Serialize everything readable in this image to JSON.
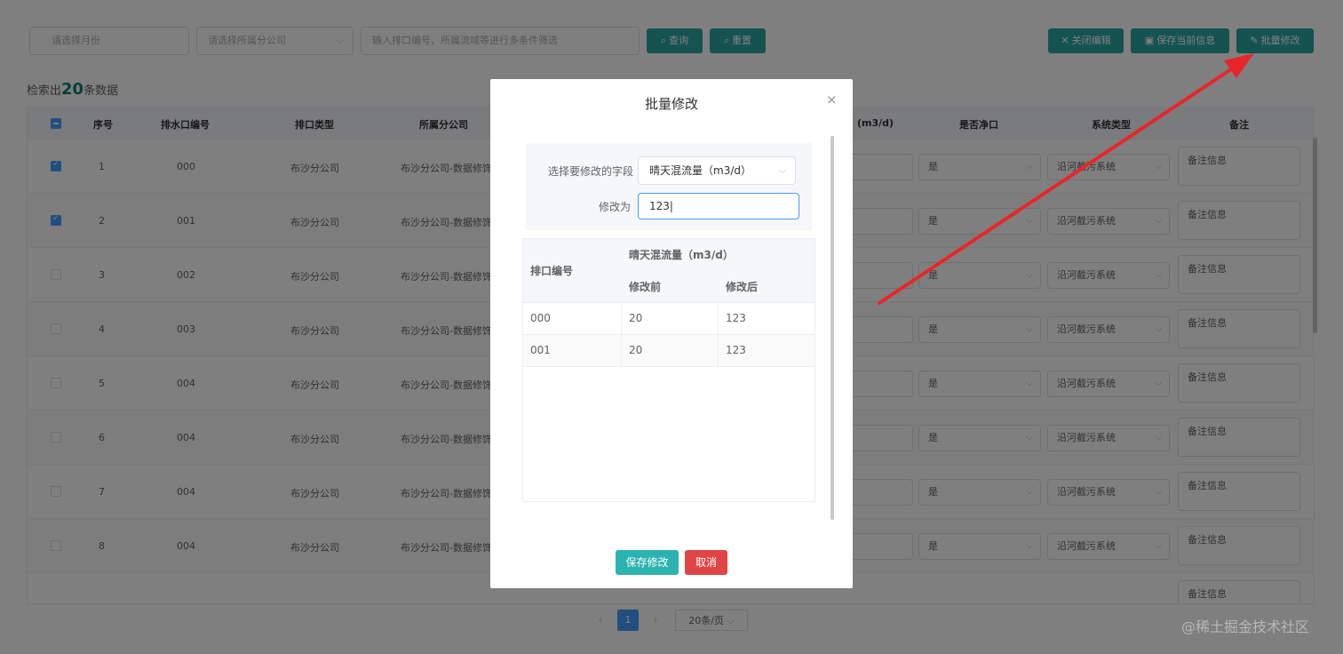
{
  "filters": {
    "month_placeholder": "请选择月份",
    "company_placeholder": "请选择所属分公司",
    "keyword_placeholder": "输入排口编号、所属流域等进行多条件筛选",
    "query_label": "查询",
    "reset_label": "重置"
  },
  "actions": {
    "close_edit_label": "关闭编辑",
    "save_current_label": "保存当前信息",
    "batch_edit_label": "批量修改"
  },
  "result": {
    "prefix": "检索出",
    "count": "20",
    "suffix": "条数据"
  },
  "table": {
    "headers": {
      "index": "序号",
      "outlet_no": "排水口编号",
      "outlet_type": "排口类型",
      "company": "所属分公司",
      "flow": "(m3/d)",
      "clean": "是否净口",
      "system": "系统类型",
      "remark": "备注"
    },
    "rows": [
      {
        "index": "1",
        "code": "000",
        "type": "布沙分公司",
        "company": "布沙分公司-数据修饰",
        "clean": "是",
        "system": "沿河截污系统",
        "remark": "备注信息",
        "checked": true
      },
      {
        "index": "2",
        "code": "001",
        "type": "布沙分公司",
        "company": "布沙分公司-数据修饰",
        "clean": "是",
        "system": "沿河截污系统",
        "remark": "备注信息",
        "checked": true
      },
      {
        "index": "3",
        "code": "002",
        "type": "布沙分公司",
        "company": "布沙分公司-数据修饰",
        "clean": "是",
        "system": "沿河截污系统",
        "remark": "备注信息",
        "checked": false
      },
      {
        "index": "4",
        "code": "003",
        "type": "布沙分公司",
        "company": "布沙分公司-数据修饰",
        "clean": "是",
        "system": "沿河截污系统",
        "remark": "备注信息",
        "checked": false
      },
      {
        "index": "5",
        "code": "004",
        "type": "布沙分公司",
        "company": "布沙分公司-数据修饰",
        "clean": "是",
        "system": "沿河截污系统",
        "remark": "备注信息",
        "checked": false
      },
      {
        "index": "6",
        "code": "004",
        "type": "布沙分公司",
        "company": "布沙分公司-数据修饰",
        "clean": "是",
        "system": "沿河截污系统",
        "remark": "备注信息",
        "checked": false
      },
      {
        "index": "7",
        "code": "004",
        "type": "布沙分公司",
        "company": "布沙分公司-数据修饰",
        "clean": "是",
        "system": "沿河截污系统",
        "remark": "备注信息",
        "checked": false
      },
      {
        "index": "8",
        "code": "004",
        "type": "布沙分公司",
        "company": "布沙分公司-数据修饰",
        "clean": "是",
        "system": "沿河截污系统",
        "remark": "备注信息",
        "checked": false
      },
      {
        "remark": "备注信息"
      }
    ]
  },
  "pagination": {
    "prev": "‹",
    "current": "1",
    "next": "›",
    "page_size": "20条/页"
  },
  "dialog": {
    "title": "批量修改",
    "close_icon": "×",
    "field_label": "选择要修改的字段",
    "field_value": "晴天混流量（m3/d）",
    "modify_label": "修改为",
    "modify_value": "123",
    "table": {
      "col_code": "排口编号",
      "col_group": "晴天混流量（m3/d）",
      "col_before": "修改前",
      "col_after": "修改后",
      "rows": [
        {
          "code": "000",
          "before": "20",
          "after": "123"
        },
        {
          "code": "001",
          "before": "20",
          "after": "123"
        }
      ]
    },
    "save_label": "保存修改",
    "cancel_label": "取消"
  },
  "watermark": "@稀土掘金技术社区",
  "colors": {
    "primary": "#2aa7a3",
    "danger": "#e04545",
    "annotation_arrow": "#e8252a"
  }
}
